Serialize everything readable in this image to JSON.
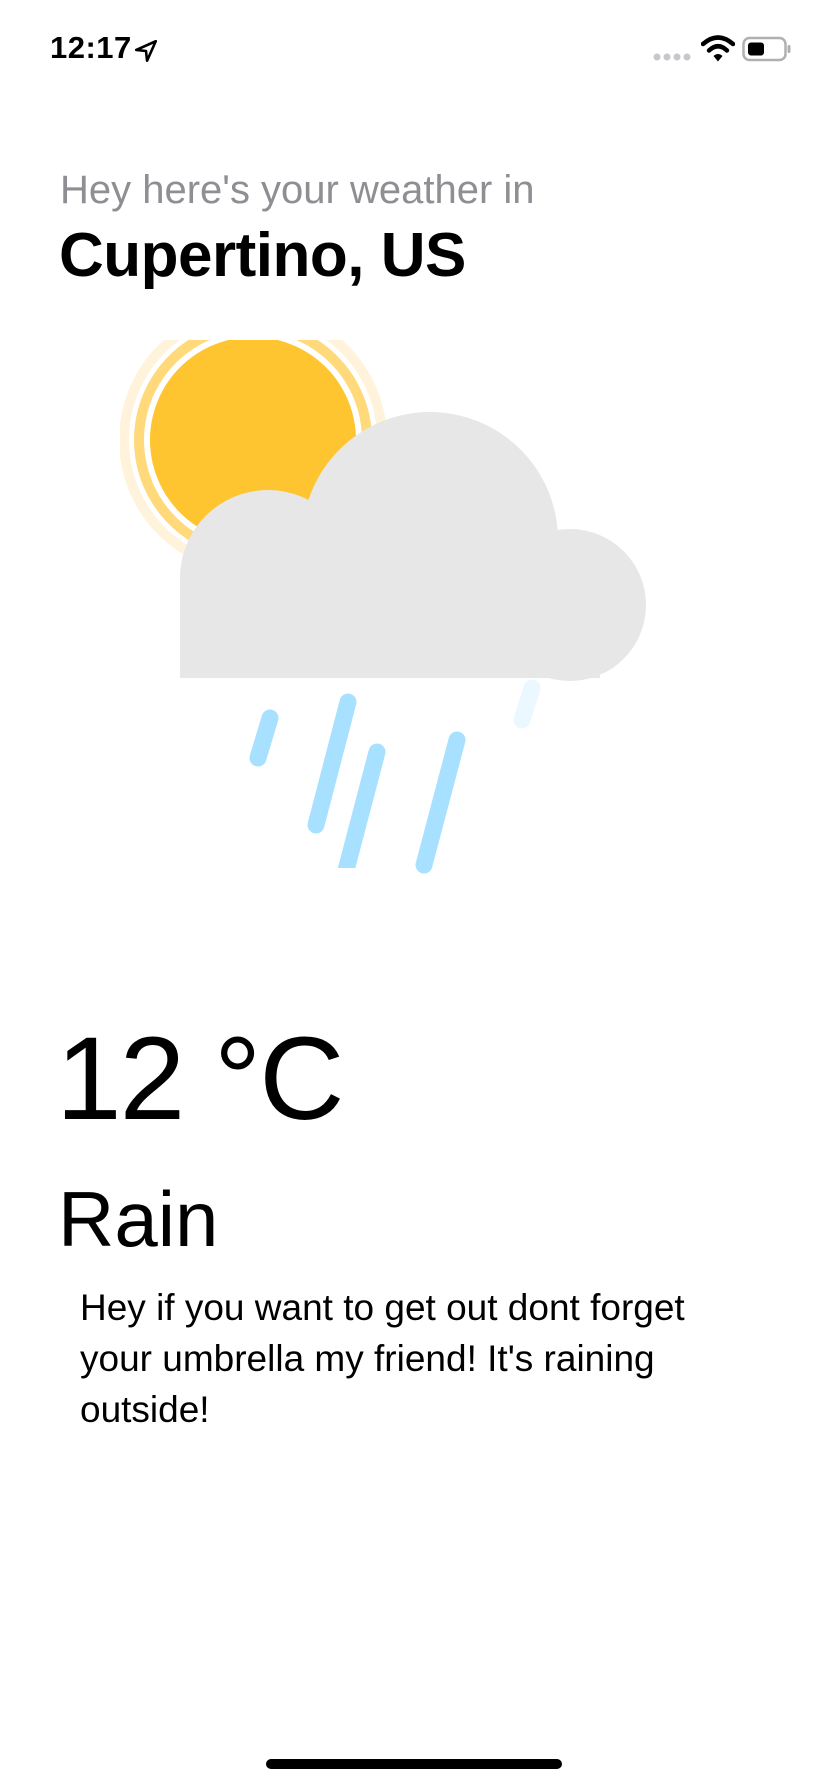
{
  "status_bar": {
    "time": "12:17",
    "icons": [
      "location-arrow-icon",
      "signal-dots-icon",
      "wifi-icon",
      "battery-icon"
    ]
  },
  "header": {
    "intro": "Hey here's your weather in",
    "city": "Cupertino, US"
  },
  "weather": {
    "icon": "sun-cloud-rain-icon",
    "temperature": "12 °C",
    "condition": "Rain",
    "message": "Hey if you want to get out dont forget your umbrella my friend! It's raining outside!"
  },
  "colors": {
    "sun": "#FFC530",
    "sun_ring": "#FFD97A",
    "cloud": "#E7E7E7",
    "rain": "#A8E1FF",
    "intro_text": "#8E8E93"
  }
}
